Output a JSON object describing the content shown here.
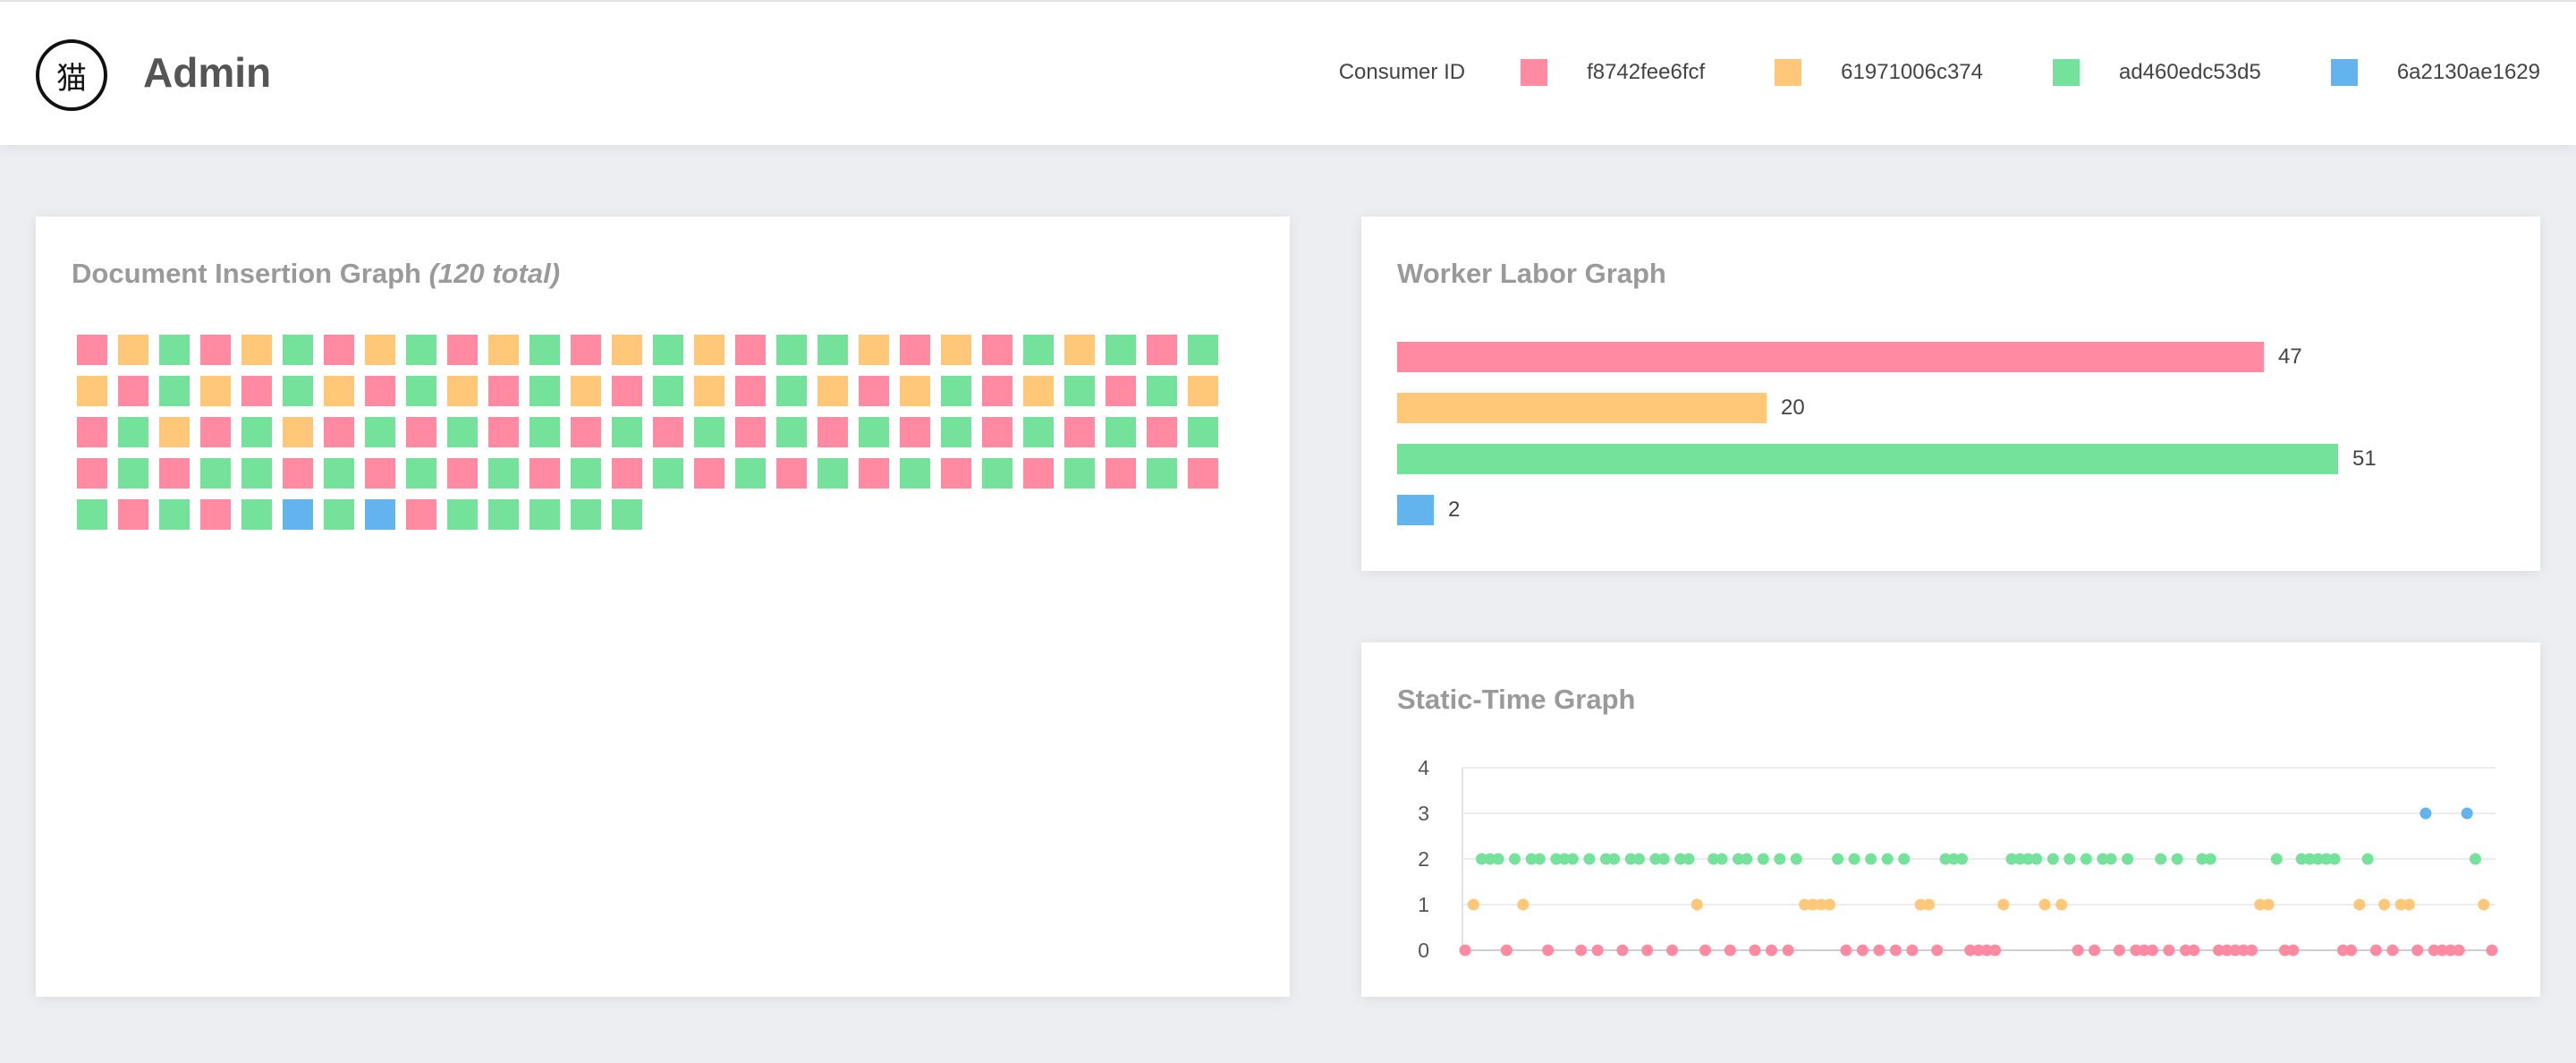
{
  "app": {
    "logo_char": "猫",
    "title": "Admin"
  },
  "legend": {
    "title": "Consumer ID",
    "consumers": [
      {
        "id": "f8742fee6fcf",
        "color": "#ff8aa2"
      },
      {
        "id": "61971006c374",
        "color": "#ffc878"
      },
      {
        "id": "ad460edc53d5",
        "color": "#75e29c"
      },
      {
        "id": "6a2130ae1629",
        "color": "#63b3ee"
      }
    ]
  },
  "document_insertion": {
    "title": "Document Insertion Graph",
    "total_label": "(120 total)",
    "sequence": [
      0,
      1,
      2,
      0,
      1,
      2,
      0,
      1,
      2,
      0,
      1,
      2,
      0,
      1,
      2,
      1,
      0,
      2,
      2,
      1,
      0,
      1,
      0,
      2,
      1,
      2,
      0,
      2,
      1,
      0,
      2,
      1,
      0,
      2,
      1,
      0,
      2,
      1,
      0,
      2,
      1,
      0,
      2,
      1,
      0,
      2,
      1,
      0,
      1,
      2,
      0,
      1,
      2,
      0,
      2,
      1,
      0,
      2,
      1,
      0,
      2,
      1,
      0,
      2,
      0,
      2,
      0,
      2,
      0,
      2,
      0,
      2,
      0,
      2,
      0,
      2,
      0,
      2,
      0,
      2,
      0,
      2,
      0,
      2,
      0,
      2,
      0,
      2,
      2,
      0,
      2,
      0,
      2,
      0,
      2,
      0,
      2,
      0,
      2,
      0,
      2,
      0,
      2,
      0,
      2,
      0,
      2,
      0,
      2,
      0,
      2,
      0,
      2,
      0,
      2,
      0,
      2,
      3,
      2,
      3,
      0,
      2,
      2,
      2,
      2,
      2
    ]
  },
  "worker_labor": {
    "title": "Worker Labor Graph",
    "chart_data": {
      "type": "bar",
      "orientation": "horizontal",
      "categories": [
        "f8742fee6fcf",
        "61971006c374",
        "ad460edc53d5",
        "6a2130ae1629"
      ],
      "values": [
        47,
        20,
        51,
        2
      ]
    }
  },
  "static_time": {
    "title": "Static-Time Graph",
    "chart_data": {
      "type": "scatter",
      "y_ticks": [
        "0",
        "1",
        "2",
        "3",
        "4"
      ],
      "ylim": [
        0,
        4
      ],
      "grid": true,
      "sequence": [
        0,
        1,
        2,
        2,
        2,
        0,
        2,
        1,
        2,
        2,
        0,
        2,
        2,
        2,
        0,
        2,
        0,
        2,
        2,
        0,
        2,
        2,
        0,
        2,
        2,
        0,
        2,
        2,
        1,
        0,
        2,
        2,
        0,
        2,
        2,
        0,
        2,
        0,
        2,
        0,
        2,
        1,
        1,
        1,
        1,
        2,
        0,
        2,
        0,
        2,
        0,
        2,
        0,
        2,
        0,
        1,
        1,
        0,
        2,
        2,
        2,
        0,
        0,
        0,
        0,
        1,
        2,
        2,
        2,
        2,
        1,
        2,
        1,
        2,
        0,
        2,
        0,
        2,
        2,
        0,
        2,
        0,
        0,
        0,
        2,
        0,
        2,
        0,
        0,
        2,
        2,
        0,
        0,
        0,
        0,
        0,
        1,
        1,
        2,
        0,
        0,
        2,
        2,
        2,
        2,
        2,
        0,
        0,
        1,
        2,
        0,
        1,
        0,
        1,
        1,
        0,
        3,
        0,
        0,
        0,
        0,
        3,
        2,
        1,
        0
      ]
    }
  }
}
